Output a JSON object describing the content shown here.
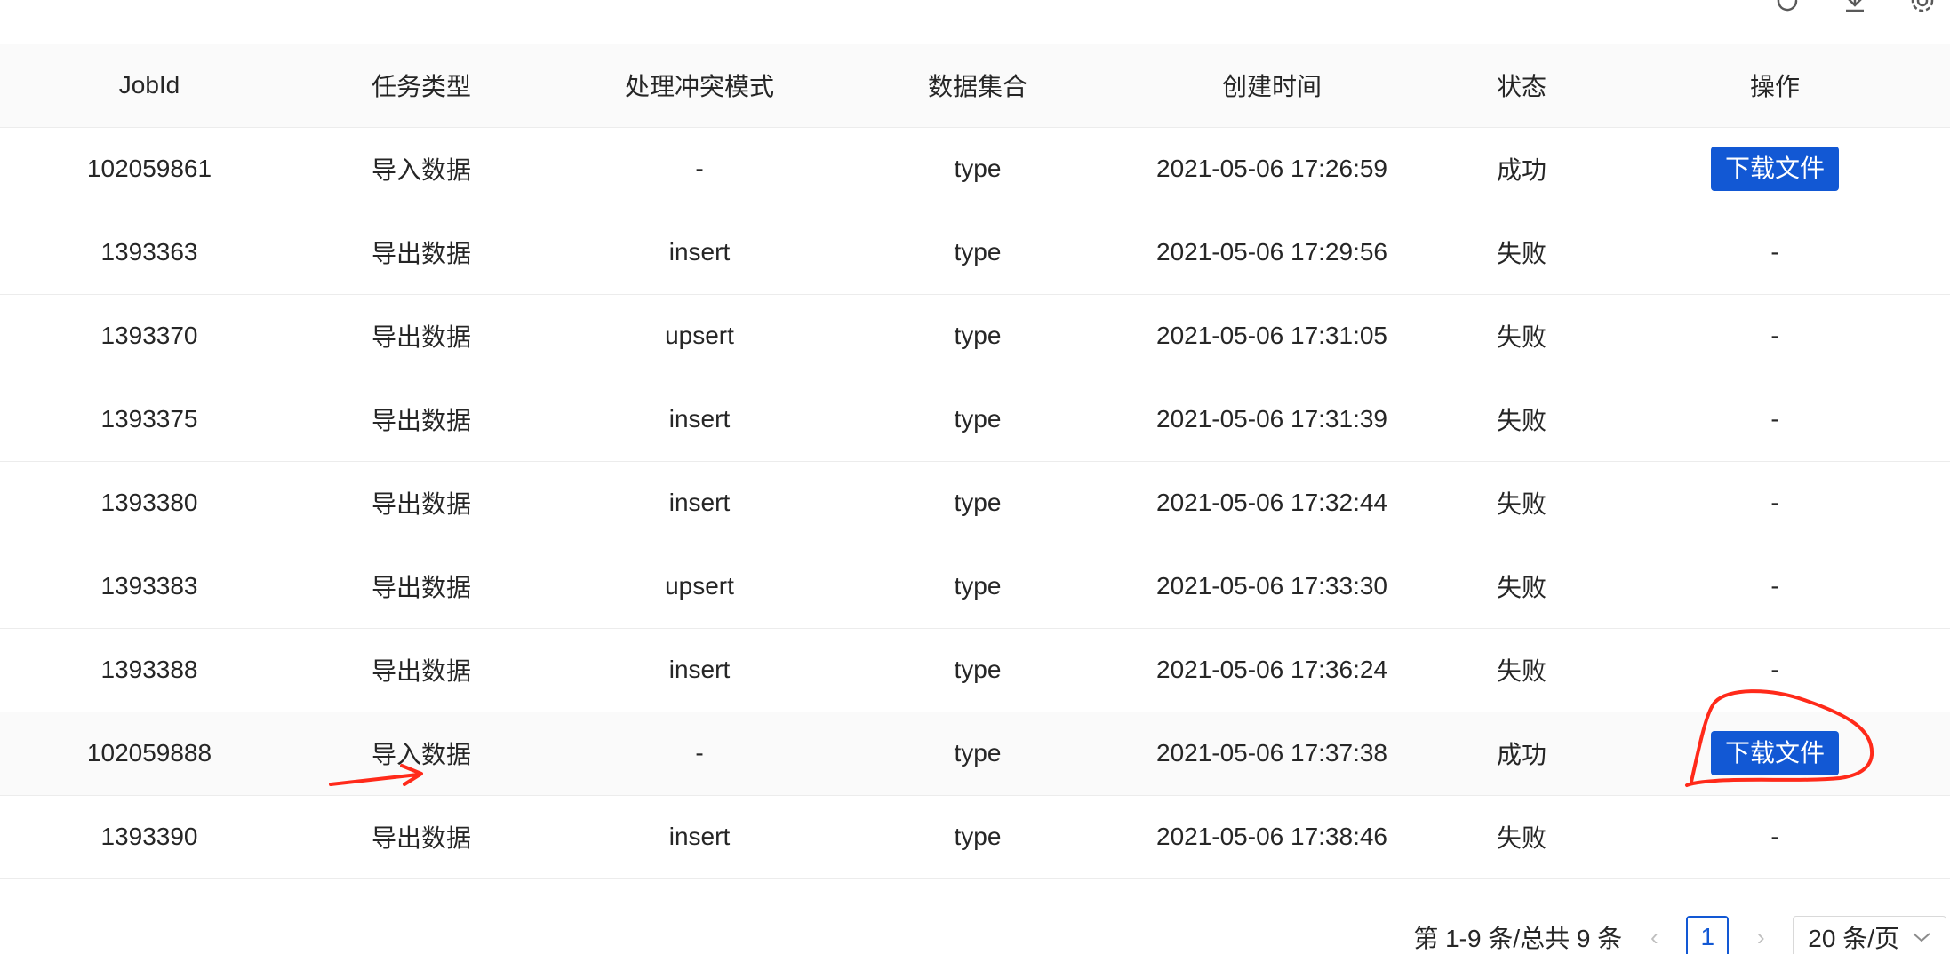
{
  "toolbar": {
    "icons": [
      "reload-icon",
      "download-icon",
      "settings-icon"
    ]
  },
  "table": {
    "columns": [
      "JobId",
      "任务类型",
      "处理冲突模式",
      "数据集合",
      "创建时间",
      "状态",
      "操作"
    ],
    "rows": [
      {
        "job_id": "102059861",
        "task_type": "导入数据",
        "conflict_mode": "-",
        "collection": "type",
        "created_at": "2021-05-06 17:26:59",
        "status": "成功",
        "action": "下载文件"
      },
      {
        "job_id": "1393363",
        "task_type": "导出数据",
        "conflict_mode": "insert",
        "collection": "type",
        "created_at": "2021-05-06 17:29:56",
        "status": "失败",
        "action": "-"
      },
      {
        "job_id": "1393370",
        "task_type": "导出数据",
        "conflict_mode": "upsert",
        "collection": "type",
        "created_at": "2021-05-06 17:31:05",
        "status": "失败",
        "action": "-"
      },
      {
        "job_id": "1393375",
        "task_type": "导出数据",
        "conflict_mode": "insert",
        "collection": "type",
        "created_at": "2021-05-06 17:31:39",
        "status": "失败",
        "action": "-"
      },
      {
        "job_id": "1393380",
        "task_type": "导出数据",
        "conflict_mode": "insert",
        "collection": "type",
        "created_at": "2021-05-06 17:32:44",
        "status": "失败",
        "action": "-"
      },
      {
        "job_id": "1393383",
        "task_type": "导出数据",
        "conflict_mode": "upsert",
        "collection": "type",
        "created_at": "2021-05-06 17:33:30",
        "status": "失败",
        "action": "-"
      },
      {
        "job_id": "1393388",
        "task_type": "导出数据",
        "conflict_mode": "insert",
        "collection": "type",
        "created_at": "2021-05-06 17:36:24",
        "status": "失败",
        "action": "-"
      },
      {
        "job_id": "102059888",
        "task_type": "导入数据",
        "conflict_mode": "-",
        "collection": "type",
        "created_at": "2021-05-06 17:37:38",
        "status": "成功",
        "action": "下载文件"
      },
      {
        "job_id": "1393390",
        "task_type": "导出数据",
        "conflict_mode": "insert",
        "collection": "type",
        "created_at": "2021-05-06 17:38:46",
        "status": "失败",
        "action": "-"
      }
    ]
  },
  "pagination": {
    "summary": "第 1-9 条/总共 9 条",
    "current_page": "1",
    "page_size": "20 条/页"
  },
  "colors": {
    "primary": "#1258d4",
    "annotation": "#ff2a1a"
  }
}
